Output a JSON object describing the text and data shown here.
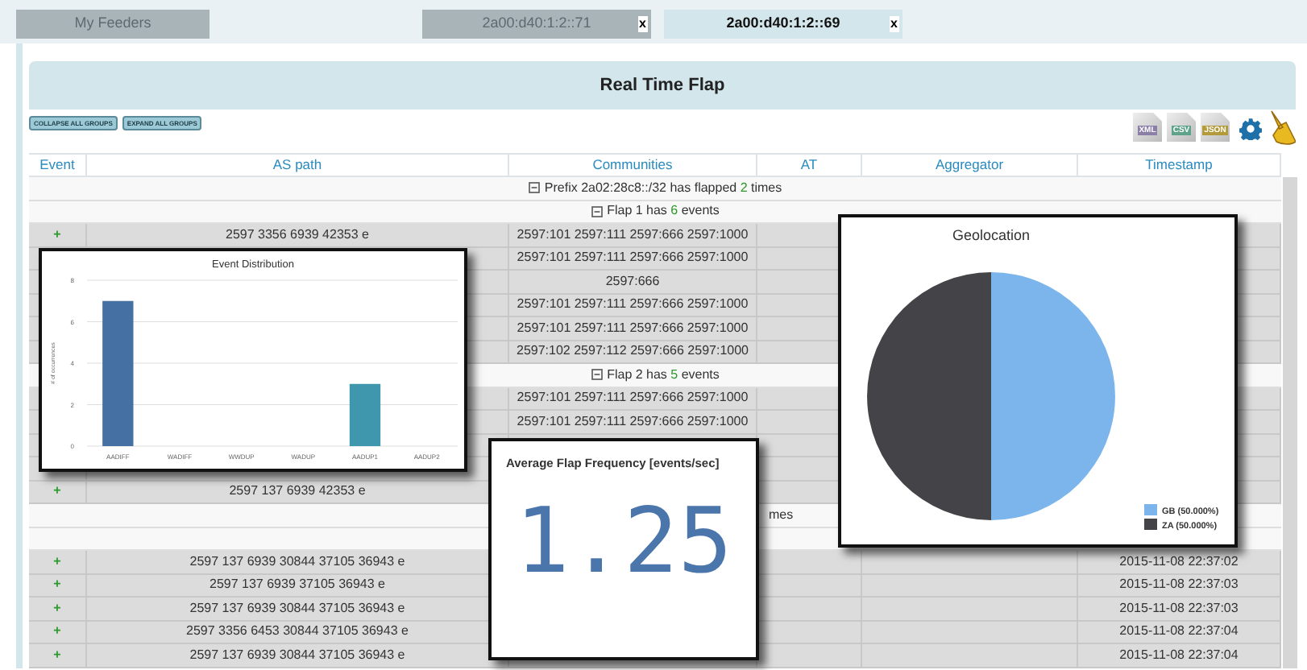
{
  "tabs": [
    {
      "label": "My Feeders",
      "selected": false
    },
    {
      "label": "2a00:d40:1:2::71",
      "close": "x",
      "selected": false
    },
    {
      "label": "2a00:d40:1:2::69",
      "close": "x",
      "selected": true
    }
  ],
  "panel": {
    "title": "Real Time Flap",
    "group_buttons": [
      "COLLAPSE ALL GROUPS",
      "EXPAND ALL GROUPS"
    ],
    "exports": [
      {
        "label": "XML",
        "color": "#8b7fa8"
      },
      {
        "label": "CSV",
        "color": "#5fa38a"
      },
      {
        "label": "JSON",
        "color": "#b39a3a"
      }
    ]
  },
  "table": {
    "columns": [
      "Event",
      "AS path",
      "Communities",
      "AT",
      "Aggregator",
      "Timestamp"
    ],
    "rows": [
      {
        "kind": "group",
        "text": "Prefix 2a02:28c8::/32 has flapped **2** times"
      },
      {
        "kind": "group",
        "text": "Flap 1 has **6** events"
      },
      {
        "kind": "event",
        "marker": "+",
        "as_path": "2597 3356 6939 42353 e",
        "communities": "2597:101 2597:111 2597:666 2597:1000"
      },
      {
        "kind": "event",
        "communities": "2597:101 2597:111 2597:666 2597:1000"
      },
      {
        "kind": "event",
        "communities": "2597:666"
      },
      {
        "kind": "event",
        "communities": "2597:101 2597:111 2597:666 2597:1000"
      },
      {
        "kind": "event",
        "communities": "2597:101 2597:111 2597:666 2597:1000"
      },
      {
        "kind": "event",
        "communities": "2597:102 2597:112 2597:666 2597:1000"
      },
      {
        "kind": "group",
        "text": "Flap 2 has **5** events"
      },
      {
        "kind": "event",
        "communities": "2597:101 2597:111 2597:666 2597:1000"
      },
      {
        "kind": "event",
        "communities": "2597:101 2597:111 2597:666 2597:1000"
      },
      {
        "kind": "event"
      },
      {
        "kind": "event"
      },
      {
        "kind": "event",
        "marker": "+",
        "as_path": "2597 137 6939 42353 e"
      },
      {
        "kind": "group",
        "tail": "mes"
      },
      {
        "kind": "group"
      },
      {
        "kind": "event",
        "marker": "+",
        "as_path": "2597 137 6939 30844 37105 36943 e",
        "timestamp": "2015-11-08 22:37:02"
      },
      {
        "kind": "event",
        "marker": "+",
        "as_path": "2597 137 6939 37105 36943 e",
        "timestamp": "2015-11-08 22:37:03"
      },
      {
        "kind": "event",
        "marker": "+",
        "as_path": "2597 137 6939 30844 37105 36943 e",
        "timestamp": "2015-11-08 22:37:03"
      },
      {
        "kind": "event",
        "marker": "+",
        "as_path": "2597 3356 6453 30844 37105 36943 e",
        "timestamp": "2015-11-08 22:37:04"
      },
      {
        "kind": "event",
        "marker": "+",
        "as_path": "2597 137 6939 30844 37105 36943 e",
        "timestamp": "2015-11-08 22:37:04"
      }
    ]
  },
  "event_distribution": {
    "chart_data": {
      "type": "bar",
      "title": "Event Distribution",
      "ylabel": "# of occurrences",
      "categories": [
        "AADIFF",
        "WADIFF",
        "WWDUP",
        "WADUP",
        "AADUP1",
        "AADUP2"
      ],
      "series": [
        {
          "color": "#4470a4",
          "values": [
            7,
            0,
            0,
            0,
            null,
            0
          ]
        },
        {
          "color": "#3f97ad",
          "values": [
            null,
            null,
            null,
            null,
            3,
            null
          ]
        }
      ],
      "stacked": true,
      "grid": true,
      "ylim": [
        0,
        8
      ],
      "yticks": [
        0,
        2,
        4,
        6,
        8
      ]
    }
  },
  "geolocation": {
    "chart_data": {
      "type": "pie",
      "title": "Geolocation",
      "categories": [
        "GB",
        "ZA"
      ],
      "values": [
        50,
        50
      ],
      "colors": [
        "#7cb5ec",
        "#434348"
      ],
      "value_labels": [
        "(50.000%)",
        "(50.000%)"
      ],
      "legend": "bottom-right"
    }
  },
  "flap_frequency": {
    "title": "Average Flap Frequency [events/sec]",
    "value": "1.25"
  }
}
